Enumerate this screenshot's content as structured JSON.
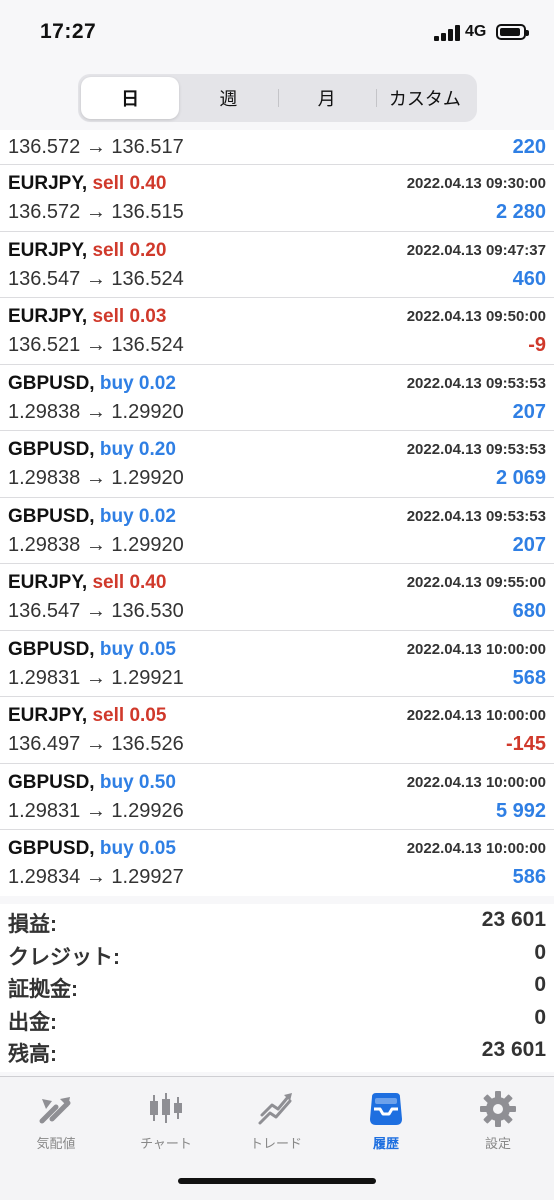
{
  "status": {
    "time": "17:27",
    "network": "4G"
  },
  "segments": [
    {
      "label": "日",
      "active": true
    },
    {
      "label": "週",
      "active": false
    },
    {
      "label": "月",
      "active": false
    },
    {
      "label": "カスタム",
      "active": false
    }
  ],
  "partial_row": {
    "prices": "136.572 → 136.517",
    "profit": "220"
  },
  "trades": [
    {
      "symbol": "EURJPY,",
      "side": "sell",
      "side_label": "sell 0.40",
      "date": "2022.04.13 09:30:00",
      "prices": "136.572 → 136.515",
      "profit": "2 280",
      "sign": "pos"
    },
    {
      "symbol": "EURJPY,",
      "side": "sell",
      "side_label": "sell 0.20",
      "date": "2022.04.13 09:47:37",
      "prices": "136.547 → 136.524",
      "profit": "460",
      "sign": "pos"
    },
    {
      "symbol": "EURJPY,",
      "side": "sell",
      "side_label": "sell 0.03",
      "date": "2022.04.13 09:50:00",
      "prices": "136.521 → 136.524",
      "profit": "-9",
      "sign": "neg"
    },
    {
      "symbol": "GBPUSD,",
      "side": "buy",
      "side_label": "buy 0.02",
      "date": "2022.04.13 09:53:53",
      "prices": "1.29838 → 1.29920",
      "profit": "207",
      "sign": "pos"
    },
    {
      "symbol": "GBPUSD,",
      "side": "buy",
      "side_label": "buy 0.20",
      "date": "2022.04.13 09:53:53",
      "prices": "1.29838 → 1.29920",
      "profit": "2 069",
      "sign": "pos"
    },
    {
      "symbol": "GBPUSD,",
      "side": "buy",
      "side_label": "buy 0.02",
      "date": "2022.04.13 09:53:53",
      "prices": "1.29838 → 1.29920",
      "profit": "207",
      "sign": "pos"
    },
    {
      "symbol": "EURJPY,",
      "side": "sell",
      "side_label": "sell 0.40",
      "date": "2022.04.13 09:55:00",
      "prices": "136.547 → 136.530",
      "profit": "680",
      "sign": "pos"
    },
    {
      "symbol": "GBPUSD,",
      "side": "buy",
      "side_label": "buy 0.05",
      "date": "2022.04.13 10:00:00",
      "prices": "1.29831 → 1.29921",
      "profit": "568",
      "sign": "pos"
    },
    {
      "symbol": "EURJPY,",
      "side": "sell",
      "side_label": "sell 0.05",
      "date": "2022.04.13 10:00:00",
      "prices": "136.497 → 136.526",
      "profit": "-145",
      "sign": "neg"
    },
    {
      "symbol": "GBPUSD,",
      "side": "buy",
      "side_label": "buy 0.50",
      "date": "2022.04.13 10:00:00",
      "prices": "1.29831 → 1.29926",
      "profit": "5 992",
      "sign": "pos"
    },
    {
      "symbol": "GBPUSD,",
      "side": "buy",
      "side_label": "buy 0.05",
      "date": "2022.04.13 10:00:00",
      "prices": "1.29834 → 1.29927",
      "profit": "586",
      "sign": "pos"
    }
  ],
  "summary": [
    {
      "label": "損益:",
      "value": "23 601"
    },
    {
      "label": "クレジット:",
      "value": "0"
    },
    {
      "label": "証拠金:",
      "value": "0"
    },
    {
      "label": "出金:",
      "value": "0"
    },
    {
      "label": "残高:",
      "value": "23 601"
    }
  ],
  "tabs": [
    {
      "label": "気配値",
      "icon": "quotes-icon",
      "active": false
    },
    {
      "label": "チャート",
      "icon": "chart-icon",
      "active": false
    },
    {
      "label": "トレード",
      "icon": "trade-icon",
      "active": false
    },
    {
      "label": "履歴",
      "icon": "history-icon",
      "active": true
    },
    {
      "label": "設定",
      "icon": "settings-icon",
      "active": false
    }
  ],
  "colors": {
    "sell": "#d0392b",
    "buy": "#2f7fe4",
    "active_tab": "#1e6fe0",
    "inactive_tab": "#888888"
  }
}
